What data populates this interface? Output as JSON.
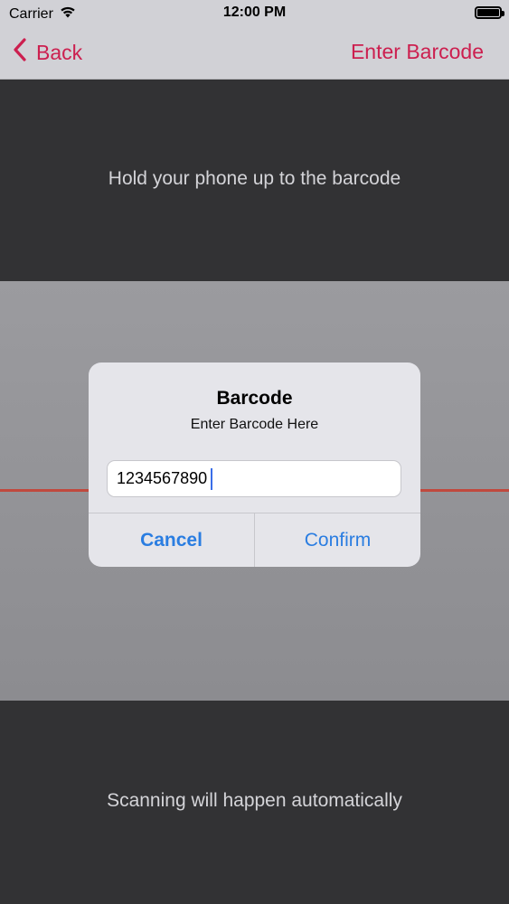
{
  "status_bar": {
    "carrier": "Carrier",
    "time": "12:00 PM",
    "wifi_icon": "wifi-icon",
    "battery_icon": "battery-icon"
  },
  "nav": {
    "back_label": "Back",
    "action_label": "Enter Barcode",
    "accent_color": "#cc1f4f"
  },
  "scanner": {
    "top_instruction": "Hold your phone up to the barcode",
    "bottom_instruction": "Scanning will happen automatically",
    "scan_line_color": "#c0493e"
  },
  "alert": {
    "title": "Barcode",
    "message": "Enter Barcode Here",
    "input_value": "1234567890",
    "cancel_label": "Cancel",
    "confirm_label": "Confirm",
    "button_color": "#2a7de1"
  }
}
